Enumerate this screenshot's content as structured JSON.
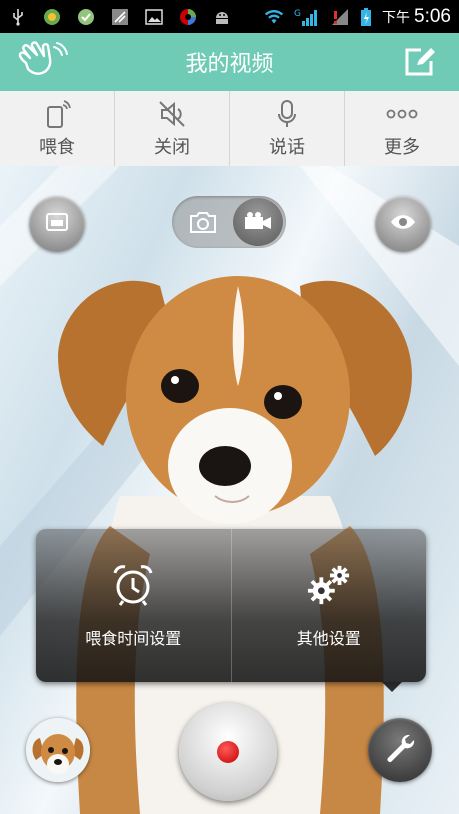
{
  "status_bar": {
    "ampm": "下午",
    "time": "5:06",
    "network": "G",
    "left_icons": [
      "usb-icon",
      "app-icon",
      "app-icon",
      "signal-app-icon",
      "image-icon",
      "app-icon",
      "android-icon"
    ]
  },
  "header": {
    "title": "我的视频",
    "left_icon": "wave-hand-icon",
    "right_icon": "edit-icon"
  },
  "actions": [
    {
      "label": "喂食",
      "icon": "phone-signal-icon"
    },
    {
      "label": "关闭",
      "icon": "mute-icon"
    },
    {
      "label": "说话",
      "icon": "microphone-icon"
    },
    {
      "label": "更多",
      "icon": "more-icon"
    }
  ],
  "camera_controls": {
    "left_icon": "window-icon",
    "mode_options": [
      "photo-icon",
      "video-camera-icon"
    ],
    "mode_selected": "video-camera-icon",
    "right_icon": "eye-icon"
  },
  "popup": {
    "items": [
      {
        "label": "喂食时间设置",
        "icon": "alarm-clock-icon"
      },
      {
        "label": "其他设置",
        "icon": "gears-icon"
      }
    ]
  },
  "bottom": {
    "avatar_icon": "puppy-avatar",
    "record_icon": "record-icon",
    "tools_icon": "wrench-icon"
  },
  "colors": {
    "header": "#6fcbb5",
    "record_dot": "#d80000"
  }
}
